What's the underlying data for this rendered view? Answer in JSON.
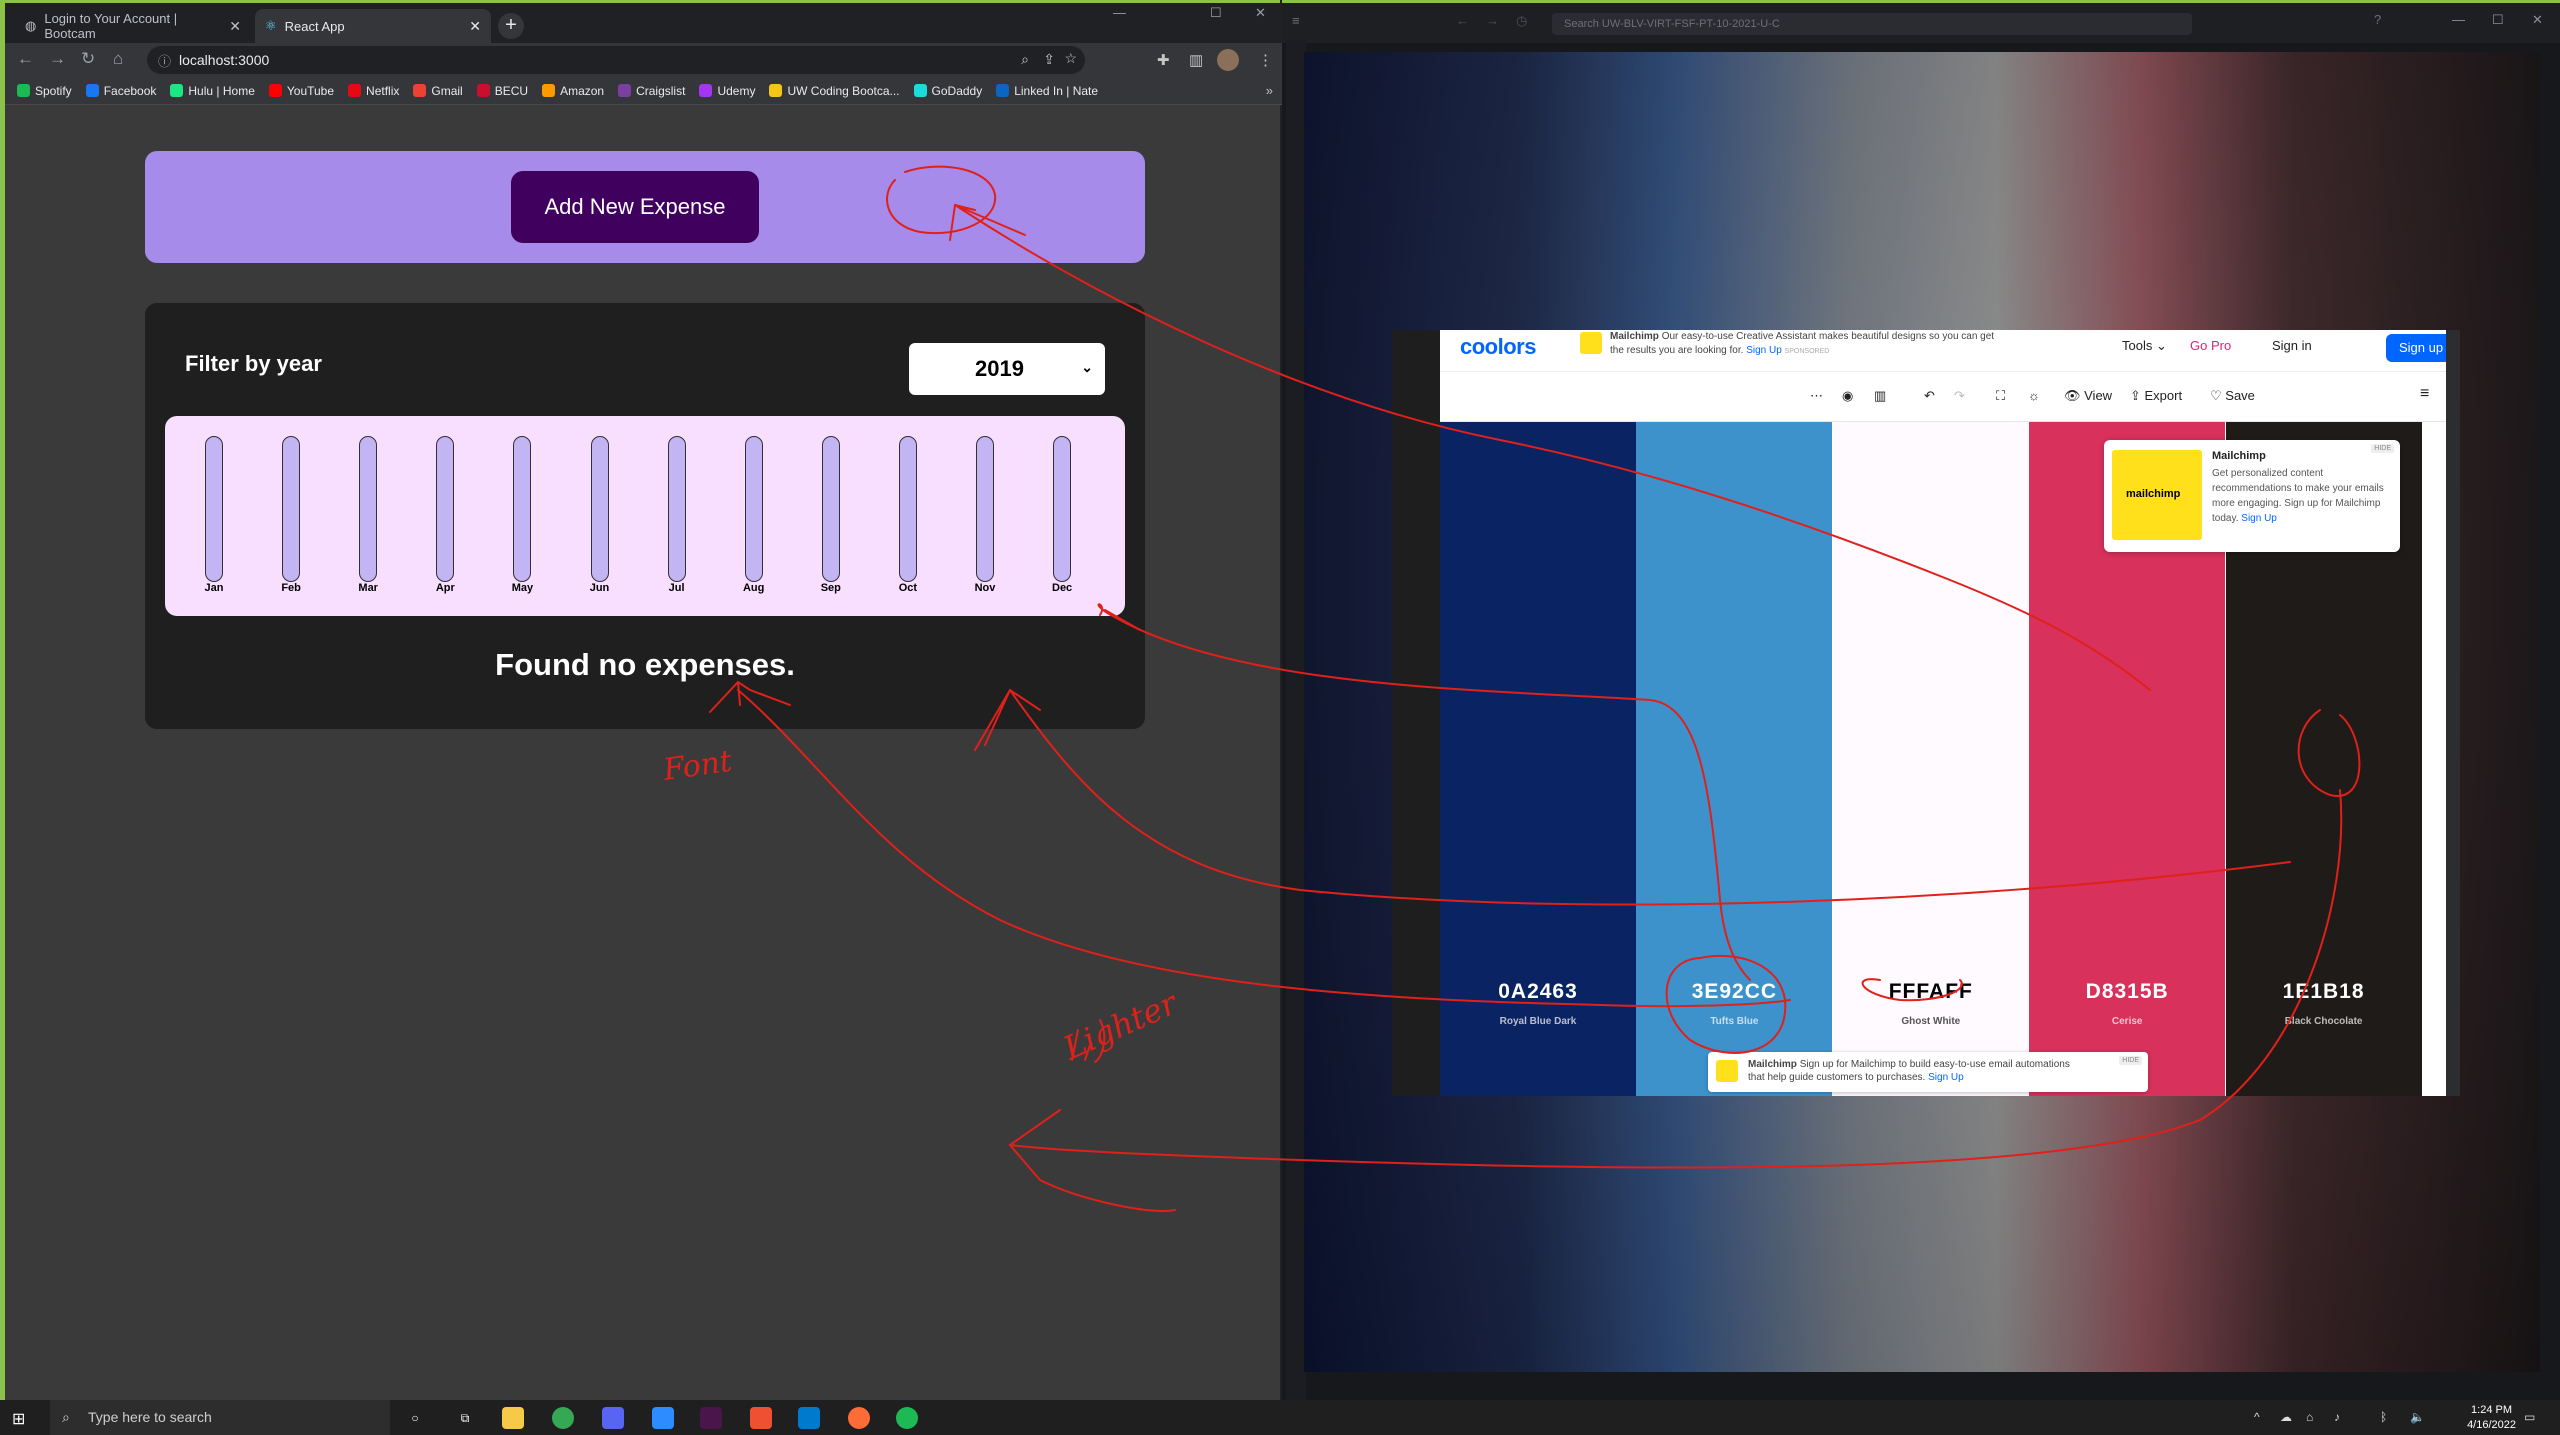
{
  "browser": {
    "tabs": [
      {
        "title": "Login to Your Account | Bootcam",
        "active": false
      },
      {
        "title": "React App",
        "active": true
      }
    ],
    "address": "localhost:3000",
    "bookmarks": [
      "Spotify",
      "Facebook",
      "Hulu | Home",
      "YouTube",
      "Netflix",
      "Gmail",
      "BECU",
      "Amazon",
      "Craigslist",
      "Udemy",
      "UW Coding Bootca...",
      "GoDaddy",
      "Linked In | Nate"
    ],
    "bookmark_colors": [
      "#1db954",
      "#1877f2",
      "#1ce783",
      "#ff0000",
      "#e50914",
      "#ea4335",
      "#c8102e",
      "#ff9900",
      "#7b3fa0",
      "#a435f0",
      "#f5c518",
      "#1bdbdb",
      "#0a66c2"
    ]
  },
  "app": {
    "add_button": "Add New Expense",
    "filter_label": "Filter by year",
    "selected_year": "2019",
    "months": [
      "Jan",
      "Feb",
      "Mar",
      "Apr",
      "May",
      "Jun",
      "Jul",
      "Aug",
      "Sep",
      "Oct",
      "Nov",
      "Dec"
    ],
    "month_fill": [
      0,
      0,
      0,
      0,
      0,
      0,
      0,
      0,
      0,
      0,
      0,
      0
    ],
    "empty_message": "Found no expenses."
  },
  "right_window": {
    "search_placeholder": "Search UW-BLV-VIRT-FSF-PT-10-2021-U-C"
  },
  "coolors": {
    "logo": "coolors",
    "ad_top_brand": "Mailchimp",
    "ad_top_text": "Our easy-to-use Creative Assistant makes beautiful designs so you can get the results you are looking for.",
    "ad_top_link": "Sign Up",
    "ad_sponsored": "SPONSORED",
    "menu": {
      "tools": "Tools",
      "go_pro": "Go Pro",
      "sign_in": "Sign in",
      "sign_up": "Sign up"
    },
    "toolbar": {
      "view": "View",
      "export": "Export",
      "save": "Save"
    },
    "palette": [
      {
        "hex": "0A2463",
        "name": "Royal Blue Dark",
        "color": "#0a2463",
        "text": "#ffffff"
      },
      {
        "hex": "3E92CC",
        "name": "Tufts Blue",
        "color": "#3e92cc",
        "text": "#ffffff"
      },
      {
        "hex": "FFFAFF",
        "name": "Ghost White",
        "color": "#fffaff",
        "text": "#000000"
      },
      {
        "hex": "D8315B",
        "name": "Cerise",
        "color": "#d8315b",
        "text": "#ffffff"
      },
      {
        "hex": "1E1B18",
        "name": "Black Chocolate",
        "color": "#1e1b18",
        "text": "#ffffff"
      }
    ],
    "ad_side": {
      "brand": "Mailchimp",
      "text": "Get personalized content recommendations to make your emails more engaging. Sign up for Mailchimp today.",
      "link": "Sign Up",
      "hide": "HIDE",
      "logo_text": "mailchimp"
    },
    "ad_bottom": {
      "brand": "Mailchimp",
      "text": "Sign up for Mailchimp to build easy-to-use email automations that help guide customers to purchases.",
      "link": "Sign Up",
      "hide": "HIDE"
    }
  },
  "annotations": {
    "font_note": "Font",
    "lighter_note": "Lighter",
    "ink_color": "#e0201a"
  },
  "taskbar": {
    "search_placeholder": "Type here to search",
    "time": "1:24 PM",
    "date": "4/16/2022"
  }
}
